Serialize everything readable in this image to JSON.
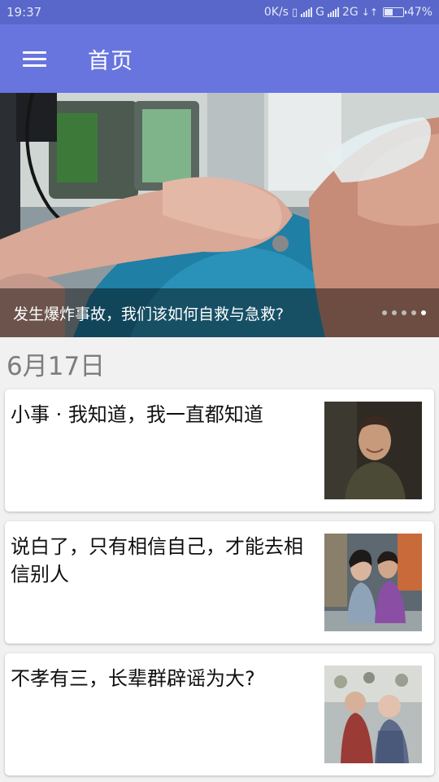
{
  "status_bar": {
    "time": "19:37",
    "speed": "0K/s",
    "network_g": "G",
    "network_2g": "2G",
    "battery": "47%",
    "battery_level": 0.47
  },
  "app_bar": {
    "title": "首页",
    "menu_icon": "hamburger-menu-icon"
  },
  "banner": {
    "caption": "发生爆炸事故，我们该如何自救与急救?",
    "dots_total": 5,
    "active_dot": 4
  },
  "feed": {
    "date": "6月17日",
    "items": [
      {
        "title": "小事 · 我知道，我一直都知道"
      },
      {
        "title": "说白了，只有相信自己，才能去相信别人"
      },
      {
        "title": "不孝有三，长辈群辟谣为大?"
      }
    ]
  },
  "colors": {
    "status_bar": "#5867c9",
    "app_bar": "#6875df",
    "background": "#f1f1f1"
  }
}
